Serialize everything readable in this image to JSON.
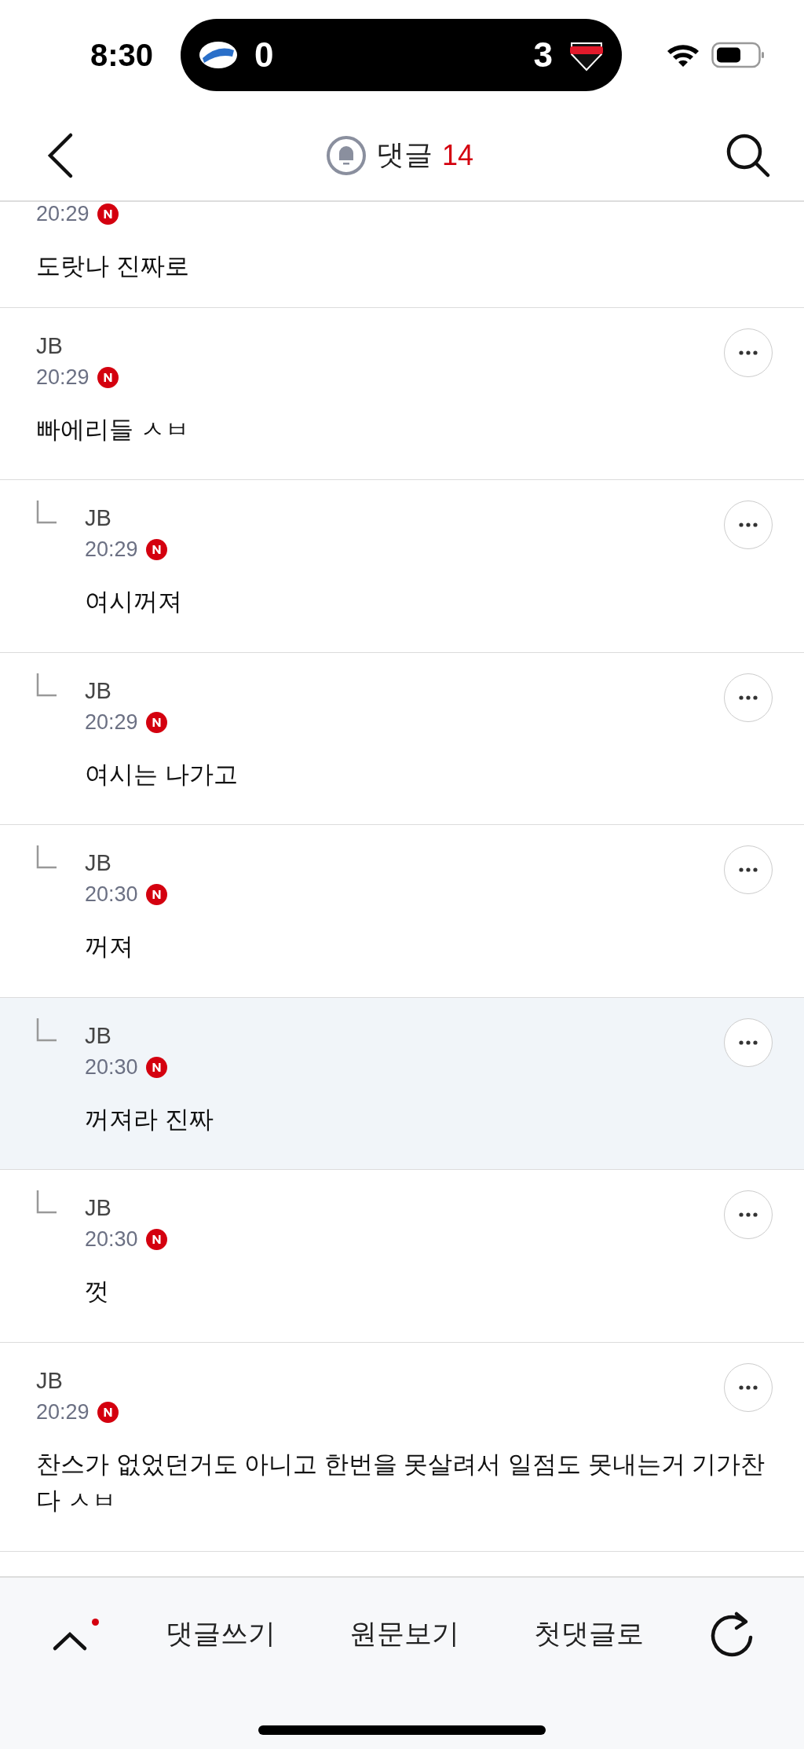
{
  "status_bar": {
    "time": "8:30",
    "score": {
      "home": "0",
      "away": "3"
    }
  },
  "header": {
    "title": "댓글",
    "count": "14"
  },
  "comments": [
    {
      "kind": "comment",
      "partial": true,
      "time": "20:29",
      "text": "도랏나 진짜로",
      "highlighted": false
    },
    {
      "kind": "comment",
      "partial": false,
      "author": "JB",
      "time": "20:29",
      "text": "빠에리들 ㅅㅂ",
      "highlighted": false
    },
    {
      "kind": "reply",
      "partial": false,
      "author": "JB",
      "time": "20:29",
      "text": "여시꺼져",
      "highlighted": false
    },
    {
      "kind": "reply",
      "partial": false,
      "author": "JB",
      "time": "20:29",
      "text": "여시는 나가고",
      "highlighted": false
    },
    {
      "kind": "reply",
      "partial": false,
      "author": "JB",
      "time": "20:30",
      "text": "꺼져",
      "highlighted": false
    },
    {
      "kind": "reply",
      "partial": false,
      "author": "JB",
      "time": "20:30",
      "text": "꺼져라 진짜",
      "highlighted": true
    },
    {
      "kind": "reply",
      "partial": false,
      "author": "JB",
      "time": "20:30",
      "text": "껏",
      "highlighted": false
    },
    {
      "kind": "comment",
      "partial": false,
      "author": "JB",
      "time": "20:29",
      "text": "찬스가 없었던거도 아니고 한번을 못살려서 일점도 못내는거 기가찬다 ㅅㅂ",
      "highlighted": false
    }
  ],
  "bottom_bar": {
    "has_new": true,
    "buttons": [
      "댓글쓰기",
      "원문보기",
      "첫댓글로"
    ]
  }
}
